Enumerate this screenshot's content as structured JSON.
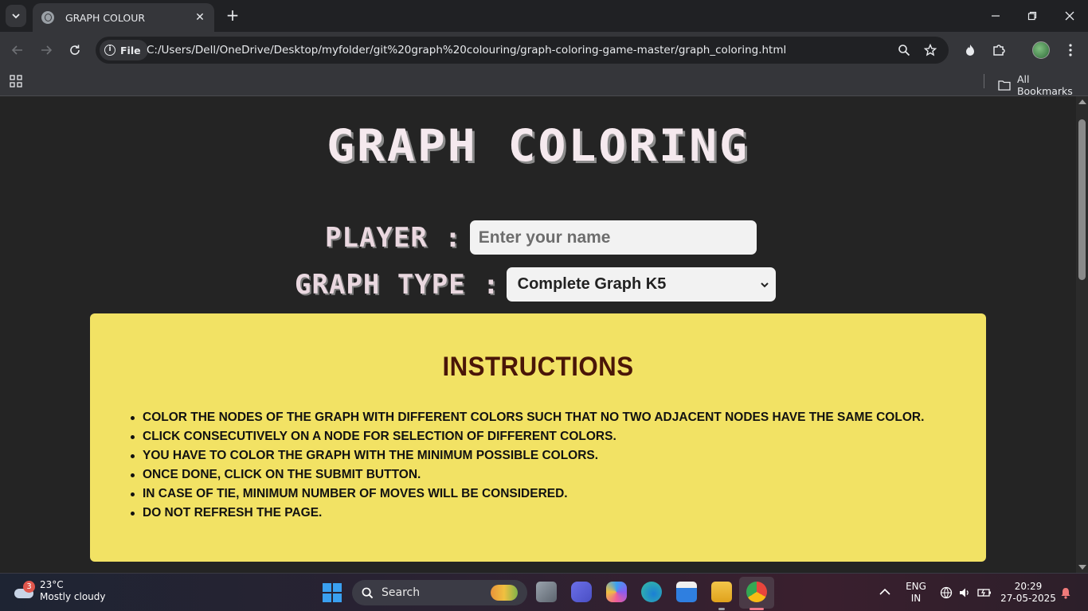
{
  "browser": {
    "tab_title": "GRAPH COLOUR",
    "new_tab": "+",
    "chip_label": "File",
    "url": "C:/Users/Dell/OneDrive/Desktop/myfolder/git%20graph%20colouring/graph-coloring-game-master/graph_coloring.html",
    "all_bookmarks": "All Bookmarks"
  },
  "page": {
    "title": "GRAPH COLORING",
    "player_label": "PLAYER :",
    "player_placeholder": "Enter your name",
    "graph_type_label": "GRAPH TYPE :",
    "graph_type_selected": "Complete Graph K5",
    "instructions": {
      "title": "INSTRUCTIONS",
      "items": [
        "Color the nodes of the graph with different colors such that no two adjacent nodes have the same color.",
        "Click consecutively on a node for selection of different colors.",
        "You have to color the graph with the minimum possible colors.",
        "Once done, click on the submit button.",
        "In case of tie, minimum number of moves will be considered.",
        "Do not refresh the page."
      ]
    }
  },
  "taskbar": {
    "weather_badge": "3",
    "temperature": "23°C",
    "condition": "Mostly cloudy",
    "search_label": "Search",
    "lang_top": "ENG",
    "lang_bottom": "IN",
    "time": "20:29",
    "date": "27-05-2025"
  },
  "colors": {
    "instructions_bg": "#f2e264",
    "instructions_title": "#4a1608",
    "page_bg": "#242424"
  }
}
